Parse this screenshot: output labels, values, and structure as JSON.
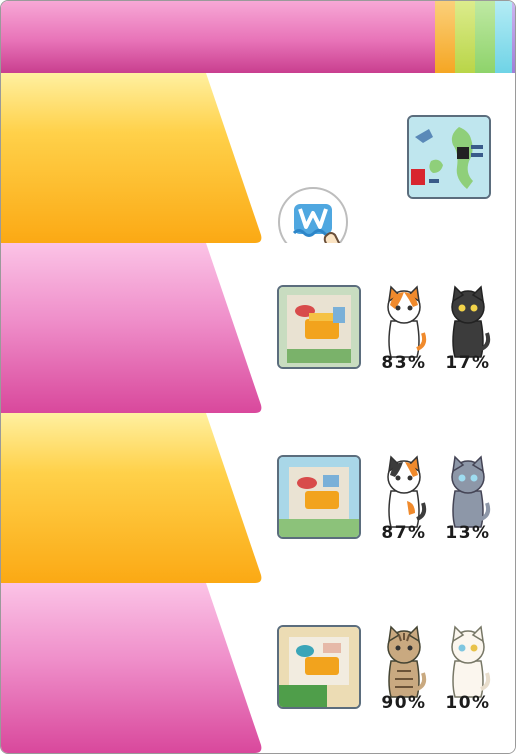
{
  "colors": {
    "pink": "#e06aaf",
    "yellow": "#fdb40e",
    "tab_orange": "#f5a623",
    "tab_yellow_green": "#b9d548",
    "tab_green": "#8ed36b",
    "tab_cyan": "#6fd3e6",
    "tab_purple": "#a07fd8"
  },
  "header": {
    "tabs": [
      "tab_orange",
      "tab_yellow_green",
      "tab_green",
      "tab_cyan",
      "tab_purple"
    ]
  },
  "rows": [
    {
      "ribbon": "yellow",
      "content": "tutorial",
      "icon": "water-logo-icon",
      "pointer": "hand-pointer-icon",
      "thumb": "map-thumbnail"
    },
    {
      "ribbon": "pink",
      "content": "vote",
      "thumb": "room-thumbnail-1",
      "left_cat": "orange-white-cat",
      "right_cat": "black-cat",
      "left_pct": "83%",
      "right_pct": "17%"
    },
    {
      "ribbon": "yellow",
      "content": "vote",
      "thumb": "room-thumbnail-2",
      "left_cat": "calico-cat",
      "right_cat": "gray-cat",
      "left_pct": "87%",
      "right_pct": "13%"
    },
    {
      "ribbon": "pink",
      "content": "vote",
      "thumb": "room-thumbnail-3",
      "left_cat": "tabby-cat",
      "right_cat": "white-cat",
      "left_pct": "90%",
      "right_pct": "10%"
    }
  ]
}
